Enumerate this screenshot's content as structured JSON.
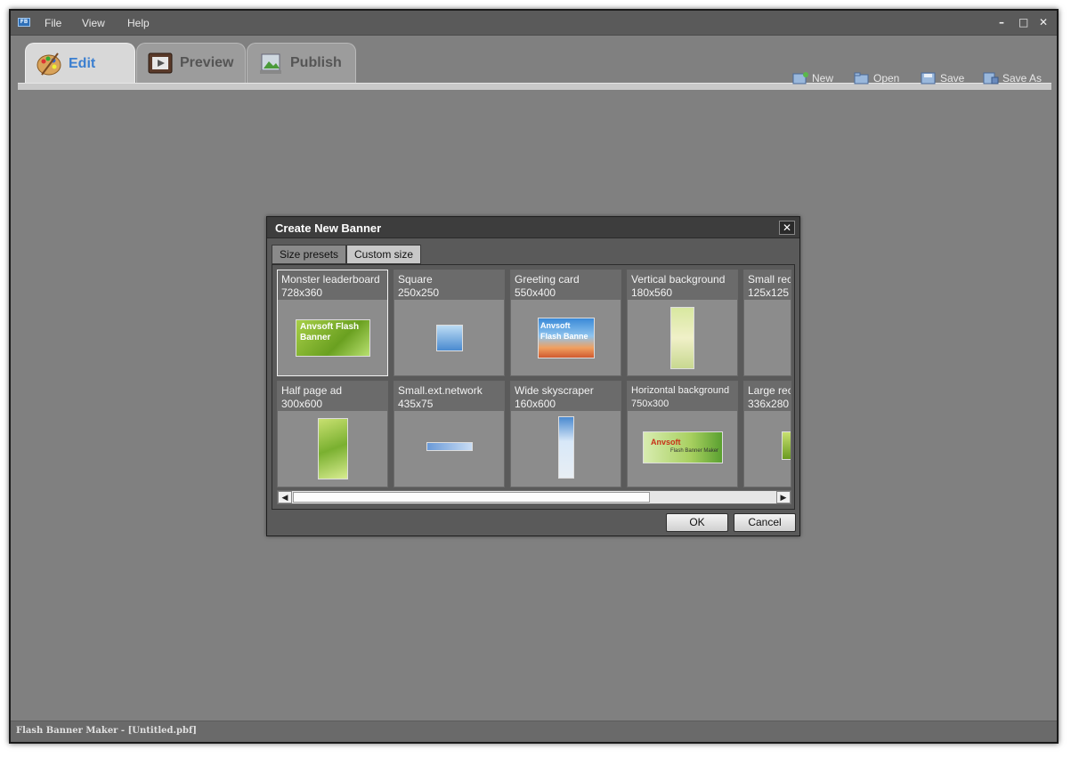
{
  "menu": {
    "items": [
      {
        "label": "File"
      },
      {
        "label": "View"
      },
      {
        "label": "Help"
      }
    ]
  },
  "window_controls": {
    "minimize": "–",
    "maximize": "□",
    "close": "✕"
  },
  "main_tabs": [
    {
      "label": "Edit",
      "active": true
    },
    {
      "label": "Preview",
      "active": false
    },
    {
      "label": "Publish",
      "active": false
    }
  ],
  "toolbar": {
    "new_label": "New",
    "open_label": "Open",
    "save_label": "Save",
    "save_as_label": "Save As"
  },
  "status": {
    "text": "Flash Banner Maker - [Untitled.pbf]"
  },
  "dialog": {
    "title": "Create New Banner",
    "close_label": "✕",
    "tabs": [
      {
        "label": "Size presets",
        "active": true
      },
      {
        "label": "Custom size",
        "active": false
      }
    ],
    "presets": [
      {
        "name": "Monster leaderboard",
        "size": "728x360",
        "selected": true,
        "thumb_text": "Anvsoft Flash Banner"
      },
      {
        "name": "Square",
        "size": "250x250",
        "selected": false
      },
      {
        "name": "Greeting card",
        "size": "550x400",
        "selected": false,
        "thumb_text": "Anvsoft Flash Banne"
      },
      {
        "name": "Vertical background",
        "size": "180x560",
        "selected": false
      },
      {
        "name": "Small rec",
        "size": "125x125",
        "selected": false
      },
      {
        "name": "Half page ad",
        "size": "300x600",
        "selected": false
      },
      {
        "name": "Small.ext.network",
        "size": "435x75",
        "selected": false
      },
      {
        "name": "Wide skyscraper",
        "size": "160x600",
        "selected": false
      },
      {
        "name": "Horizontal background",
        "size": "750x300",
        "selected": false,
        "thumb_text": "Anvsoft",
        "thumb_subtext": "Flash Banner Maker"
      },
      {
        "name": "Large rec",
        "size": "336x280",
        "selected": false
      }
    ],
    "scroll_left": "◀",
    "scroll_right": "▶",
    "ok_label": "OK",
    "cancel_label": "Cancel"
  },
  "colors": {
    "app_background": "#808080",
    "active_tab_text": "#3b7fd0",
    "dialog_background": "#5a5a5a"
  }
}
